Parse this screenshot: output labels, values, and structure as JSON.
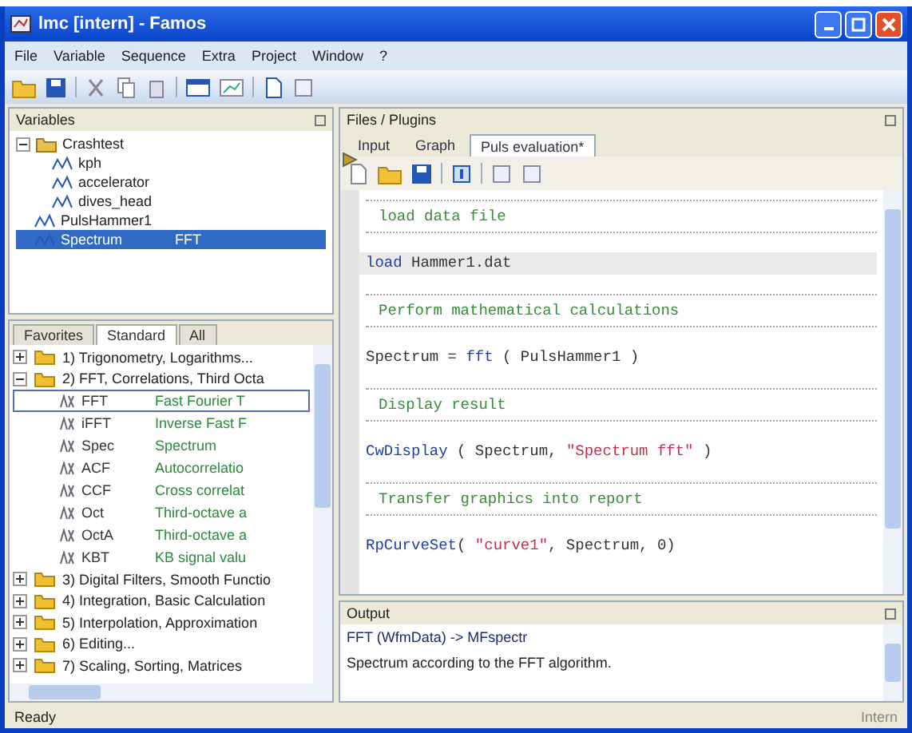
{
  "window": {
    "title": "lmc [intern] - Famos"
  },
  "menu": [
    "File",
    "Variable",
    "Sequence",
    "Extra",
    "Project",
    "Window",
    "?"
  ],
  "variables": {
    "title": "Variables",
    "tree": [
      {
        "name": "Crashtest",
        "kind": "group",
        "expanded": true,
        "selected": false,
        "children": [
          {
            "name": "kph",
            "kind": "var",
            "selected": false
          },
          {
            "name": "accelerator",
            "kind": "var",
            "selected": false
          },
          {
            "name": "dives_head",
            "kind": "var",
            "selected": false
          }
        ]
      },
      {
        "name": "PulsHammer1",
        "kind": "var",
        "selected": false
      },
      {
        "name": "Spectrum",
        "kind": "var",
        "value": "FFT",
        "selected": true
      }
    ]
  },
  "functions": {
    "tabs": [
      {
        "label": "Favorites",
        "selected": false
      },
      {
        "label": "Standard",
        "selected": true
      },
      {
        "label": "All",
        "selected": false
      }
    ],
    "groups": [
      {
        "name": "1) Trigonometry, Logarithms...",
        "expanded": false
      },
      {
        "name": "2) FFT, Correlations, Third Octa",
        "expanded": true,
        "children": [
          {
            "name": "FFT",
            "description": "Fast Fourier T",
            "selected": true
          },
          {
            "name": "iFFT",
            "description": "Inverse Fast F",
            "selected": false
          },
          {
            "name": "Spec",
            "description": "Spectrum",
            "selected": false
          },
          {
            "name": "ACF",
            "description": "Autocorrelatio",
            "selected": false
          },
          {
            "name": "CCF",
            "description": "Cross correlat",
            "selected": false
          },
          {
            "name": "Oct",
            "description": "Third-octave a",
            "selected": false
          },
          {
            "name": "OctA",
            "description": "Third-octave a",
            "selected": false
          },
          {
            "name": "KBT",
            "description": "KB signal valu",
            "selected": false
          }
        ]
      },
      {
        "name": "3) Digital Filters, Smooth Functio",
        "expanded": false
      },
      {
        "name": "4) Integration, Basic Calculation",
        "expanded": false
      },
      {
        "name": "5) Interpolation, Approximation",
        "expanded": false
      },
      {
        "name": "6) Editing...",
        "expanded": false
      },
      {
        "name": "7) Scaling, Sorting, Matrices",
        "expanded": false
      }
    ]
  },
  "editor": {
    "title": "Files / Plugins",
    "tabs": [
      {
        "label": "Input",
        "selected": false
      },
      {
        "label": "Graph",
        "selected": false
      },
      {
        "label": "Puls evaluation*",
        "selected": true
      }
    ],
    "lines": [
      {
        "kind": "comment",
        "text": "load data file"
      },
      {
        "kind": "code",
        "current": true,
        "segments": [
          {
            "kind": "func",
            "text": "load"
          },
          {
            "kind": "plain",
            "text": " Hammer1.dat"
          }
        ]
      },
      {
        "kind": "comment",
        "text": "Perform mathematical calculations"
      },
      {
        "kind": "code",
        "current": false,
        "segments": [
          {
            "kind": "plain",
            "text": "Spectrum = "
          },
          {
            "kind": "func",
            "text": "fft"
          },
          {
            "kind": "plain",
            "text": " ( PulsHammer1 )"
          }
        ]
      },
      {
        "kind": "comment",
        "text": "Display result"
      },
      {
        "kind": "code",
        "current": false,
        "segments": [
          {
            "kind": "func",
            "text": "CwDisplay"
          },
          {
            "kind": "plain",
            "text": " ( Spectrum, "
          },
          {
            "kind": "string",
            "text": "\"Spectrum fft\""
          },
          {
            "kind": "plain",
            "text": " )"
          }
        ]
      },
      {
        "kind": "comment",
        "text": "Transfer graphics into report"
      },
      {
        "kind": "code",
        "current": false,
        "segments": [
          {
            "kind": "func",
            "text": "RpCurveSet"
          },
          {
            "kind": "plain",
            "text": "( "
          },
          {
            "kind": "string",
            "text": "\"curve1\""
          },
          {
            "kind": "plain",
            "text": ", Spectrum, 0)"
          }
        ]
      }
    ]
  },
  "output": {
    "title": "Output",
    "lines": [
      {
        "text": "FFT (WfmData) -> MFspectr",
        "kind": "signature"
      },
      {
        "text": "Spectrum according to the FFT algorithm.",
        "kind": "plain"
      }
    ]
  },
  "status_bar": {
    "left": "Ready",
    "right": "Intern"
  }
}
